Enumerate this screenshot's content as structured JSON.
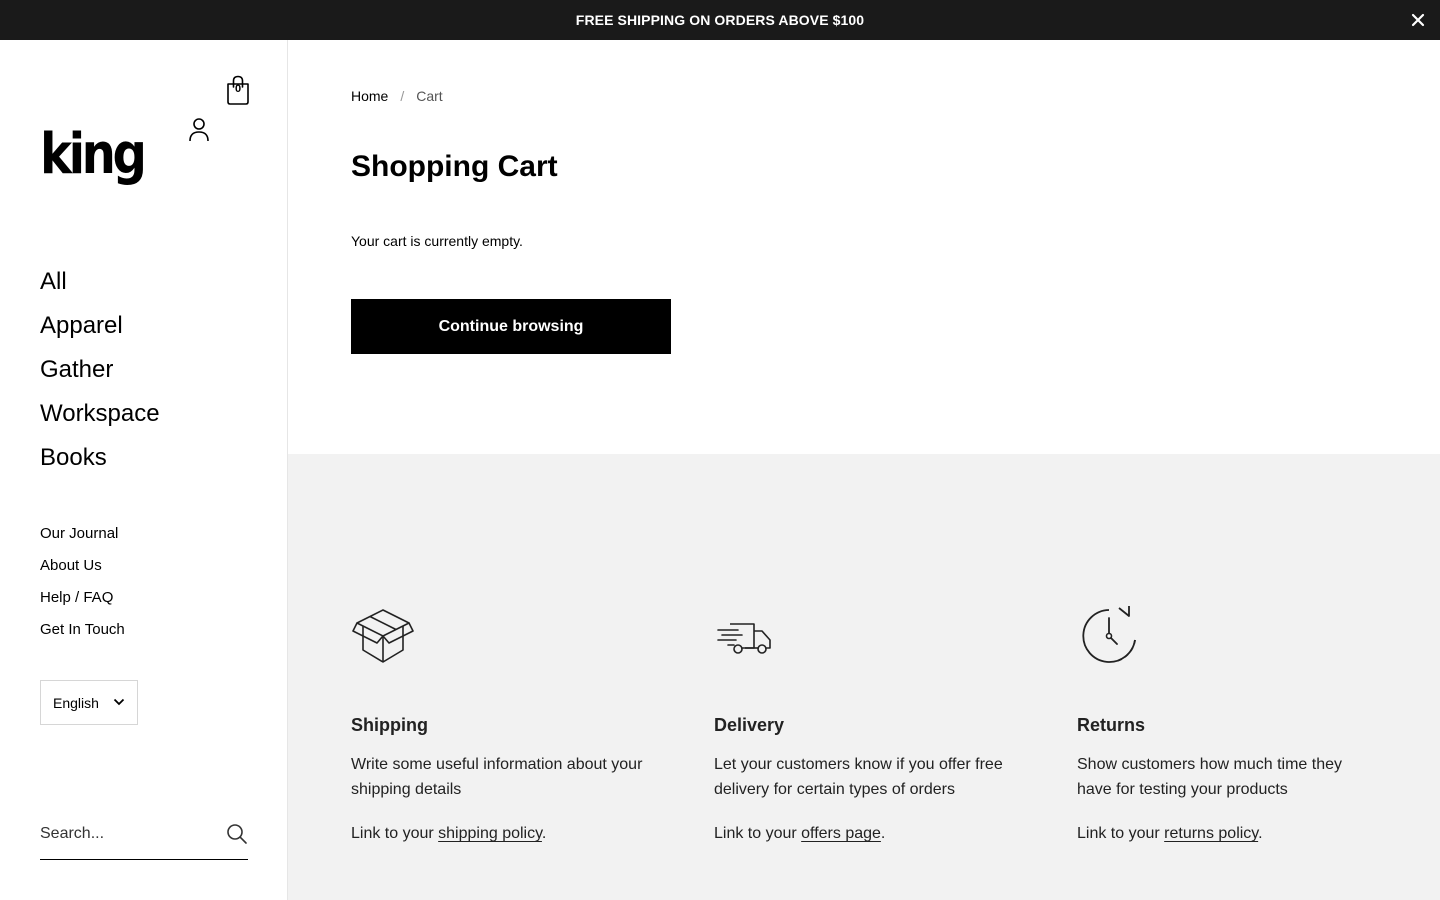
{
  "announcement": {
    "text": "FREE SHIPPING ON ORDERS ABOVE $100",
    "close_icon": "close-icon"
  },
  "header": {
    "cart_count": "0",
    "cart_icon": "shopping-bag-icon",
    "account_icon": "user-icon",
    "logo_text": "king"
  },
  "primary_nav": [
    {
      "label": "All"
    },
    {
      "label": "Apparel"
    },
    {
      "label": "Gather"
    },
    {
      "label": "Workspace"
    },
    {
      "label": "Books"
    }
  ],
  "secondary_nav": [
    {
      "label": "Our Journal"
    },
    {
      "label": "About Us"
    },
    {
      "label": "Help / FAQ"
    },
    {
      "label": "Get In Touch"
    }
  ],
  "language": {
    "selected": "English"
  },
  "search": {
    "placeholder": "Search..."
  },
  "breadcrumb": {
    "home": "Home",
    "separator": "/",
    "current": "Cart"
  },
  "cart": {
    "title": "Shopping Cart",
    "empty_message": "Your cart is currently empty.",
    "continue_label": "Continue browsing"
  },
  "features": [
    {
      "icon": "box-icon",
      "title": "Shipping",
      "description": "Write some useful information about your shipping details",
      "link_prefix": "Link to your ",
      "link_text": "shipping policy",
      "link_suffix": "."
    },
    {
      "icon": "truck-icon",
      "title": "Delivery",
      "description": "Let your customers know if you offer free delivery for certain types of orders",
      "link_prefix": "Link to your ",
      "link_text": "offers page",
      "link_suffix": "."
    },
    {
      "icon": "clock-return-icon",
      "title": "Returns",
      "description": "Show customers how much time they have for testing your products",
      "link_prefix": "Link to your ",
      "link_text": "returns policy",
      "link_suffix": "."
    }
  ],
  "colors": {
    "announcement_bg": "#1a1a1a",
    "button_bg": "#000000",
    "features_bg": "#f2f2f2"
  }
}
